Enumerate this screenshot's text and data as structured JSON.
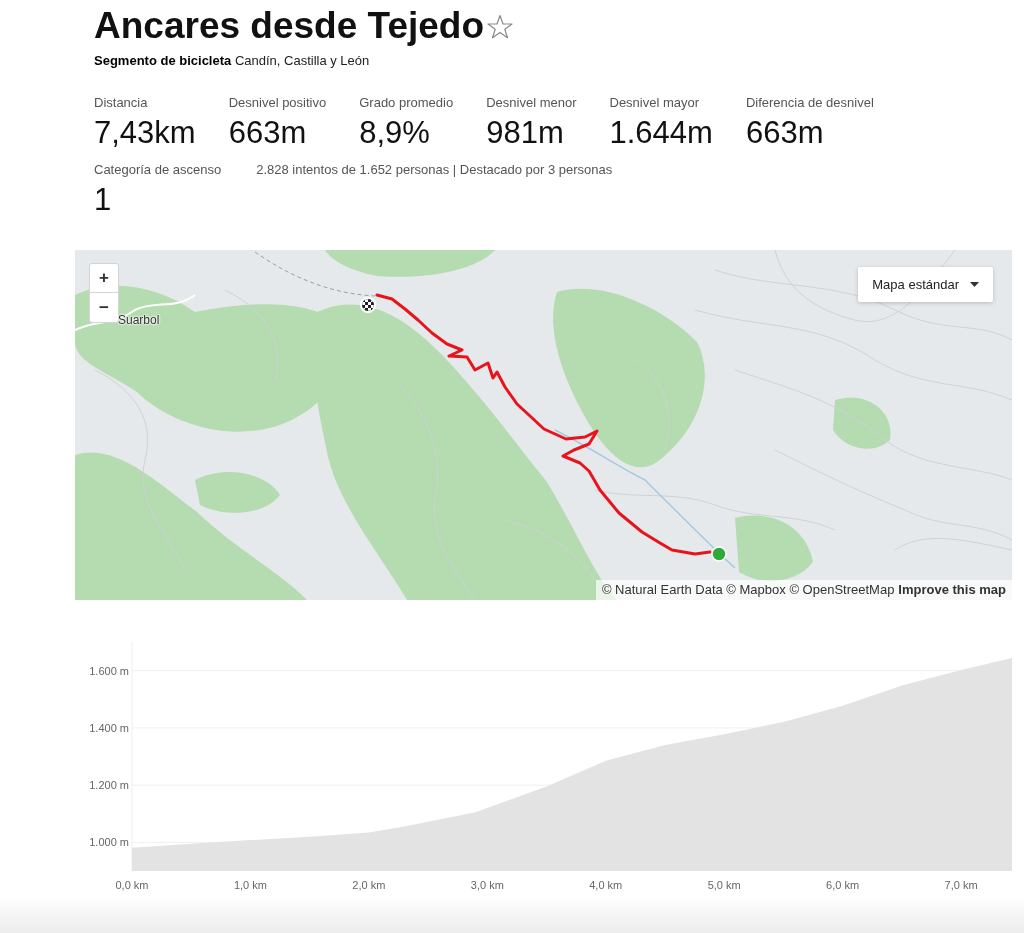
{
  "segment": {
    "title": "Ancares desde Tejedo",
    "starred": false,
    "subtitle": "**Segmento de bicicleta** Candín, Castilla y León"
  },
  "stats": [
    {
      "label": "Distancia",
      "value": "7,43km"
    },
    {
      "label": "Desnivel positivo",
      "value": "663m"
    },
    {
      "label": "Grado promedio",
      "value": "8,9%"
    },
    {
      "label": "Desnivel menor",
      "value": "981m"
    },
    {
      "label": "Desnivel mayor",
      "value": "1.644m"
    },
    {
      "label": "Diferencia de desnivel",
      "value": "663m"
    }
  ],
  "climb": {
    "label": "Categoría de ascenso",
    "value": "1",
    "summary": "2.828 intentos de 1.652 personas | Destacado por 3 personas"
  },
  "map": {
    "zoom_controls": [
      {
        "kind": "zoom_in",
        "label": "+"
      },
      {
        "kind": "zoom_out",
        "label": "−"
      }
    ],
    "style_dropdown": "Mapa estándar",
    "place_labels": [
      "Suarbol"
    ],
    "attribution": "© Natural Earth Data © Mapbox © OpenStreetMap",
    "attribution_link": "Improve this map"
  },
  "elevation_profile": {
    "chart_data": {
      "type": "area",
      "grid": true,
      "x": [
        0,
        0.5,
        1,
        1.5,
        2,
        2.3,
        2.9,
        3.5,
        4,
        4.5,
        5,
        5.5,
        6,
        6.5,
        7,
        7.43
      ],
      "values": [
        981,
        995,
        1008,
        1020,
        1035,
        1055,
        1105,
        1195,
        1285,
        1340,
        1378,
        1421,
        1477,
        1548,
        1602,
        1644
      ],
      "xlim": [
        0,
        7.43
      ],
      "ylim": [
        900,
        1700
      ],
      "xticks": [
        {
          "value": 0,
          "label": "0,0 km"
        },
        {
          "value": 1,
          "label": "1,0 km"
        },
        {
          "value": 2,
          "label": "2,0 km"
        },
        {
          "value": 3,
          "label": "3,0 km"
        },
        {
          "value": 4,
          "label": "4,0 km"
        },
        {
          "value": 5,
          "label": "5,0 km"
        },
        {
          "value": 6,
          "label": "6,0 km"
        },
        {
          "value": 7,
          "label": "7,0 km"
        }
      ],
      "yticks": [
        {
          "value": 1000,
          "label": "1.000 m"
        },
        {
          "value": 1200,
          "label": "1.200 m"
        },
        {
          "value": 1400,
          "label": "1.400 m"
        },
        {
          "value": 1600,
          "label": "1.600 m"
        }
      ]
    }
  }
}
